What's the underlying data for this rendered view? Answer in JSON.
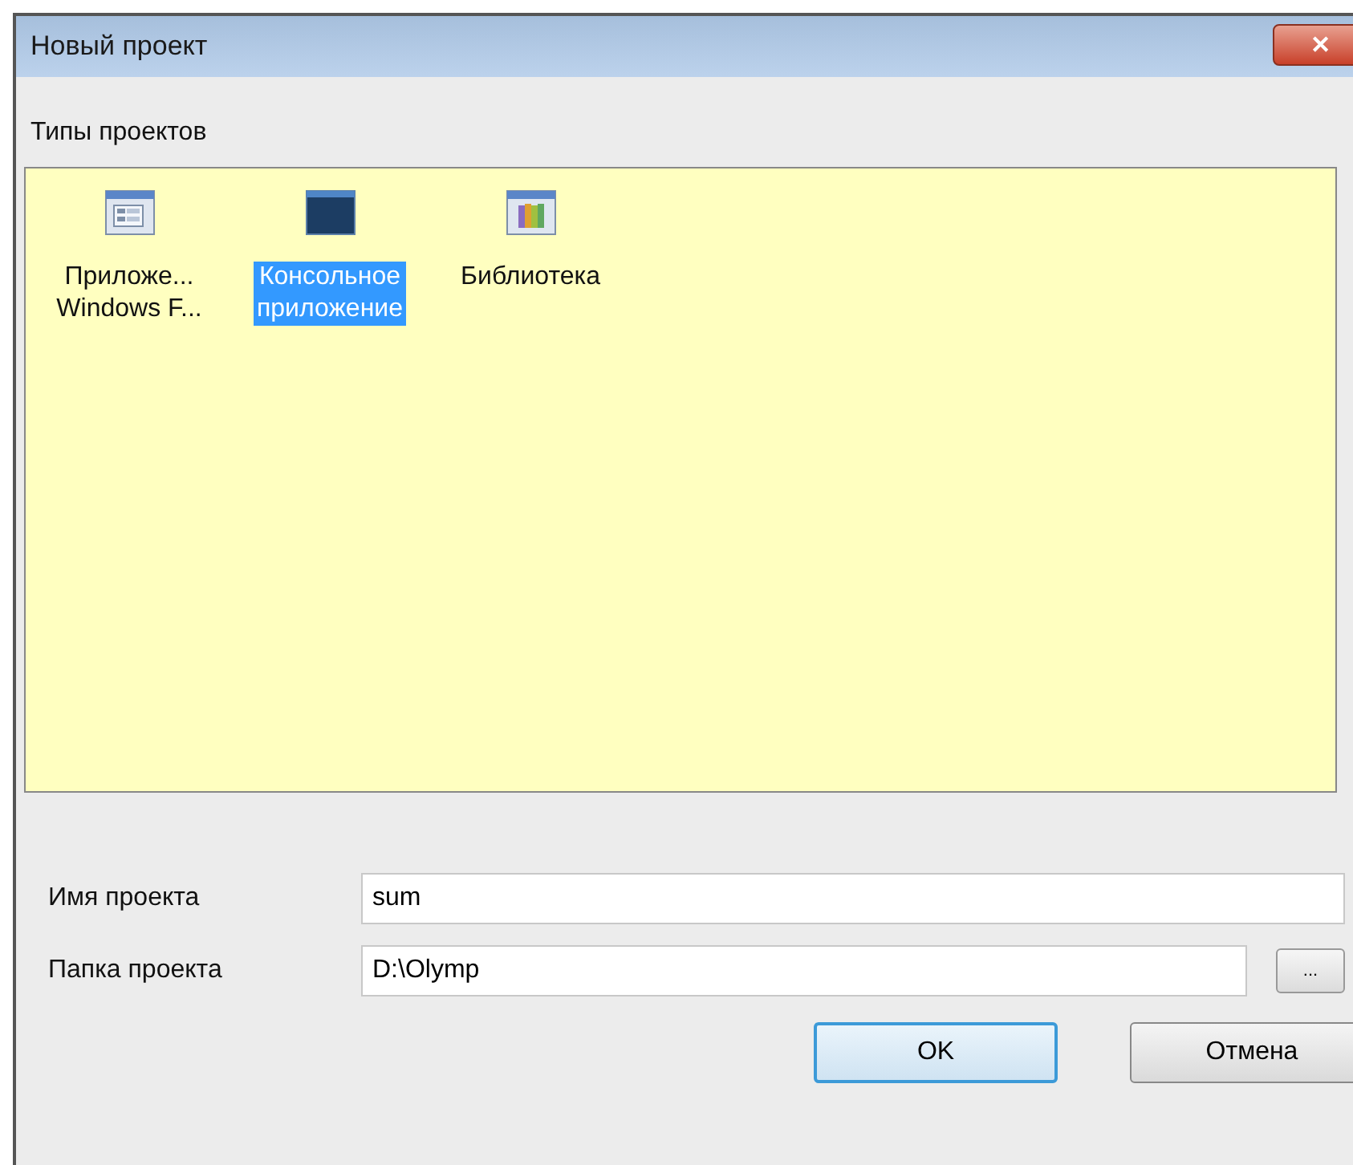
{
  "window": {
    "title": "Новый проект",
    "close": "✕"
  },
  "project_types": {
    "label": "Типы проектов",
    "items": [
      {
        "kind": "form",
        "label": [
          "Приложе...",
          "Windows F..."
        ],
        "selected": false
      },
      {
        "kind": "console",
        "label": [
          "Консольное",
          "приложение"
        ],
        "selected": true
      },
      {
        "kind": "library",
        "label": [
          "Библиотека"
        ],
        "selected": false
      }
    ]
  },
  "fields": [
    {
      "label": "Имя проекта",
      "value": "sum"
    },
    {
      "label": "Папка проекта",
      "value": "D:\\Olymp",
      "browse": "..."
    }
  ],
  "buttons": [
    {
      "label": "OK",
      "default": true
    },
    {
      "label": "Отмена",
      "default": false
    }
  ]
}
